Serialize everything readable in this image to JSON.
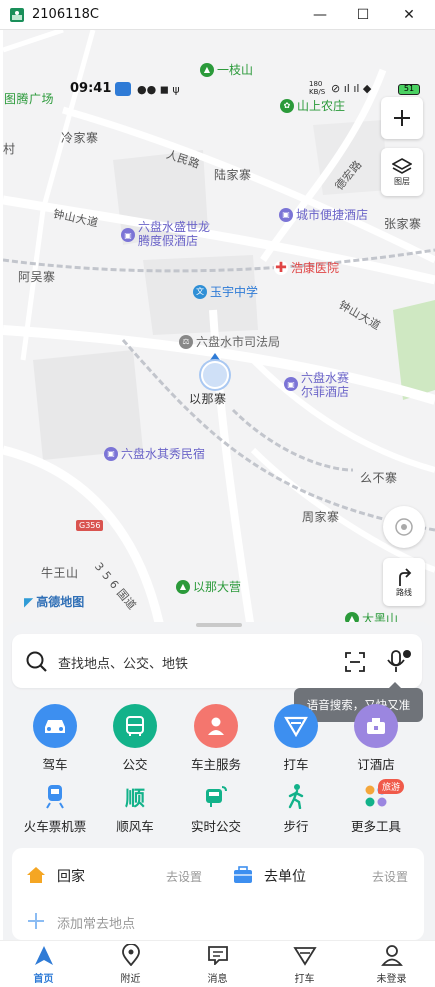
{
  "window": {
    "title": "2106118C",
    "minimize": "—",
    "maximize": "☐",
    "close": "✕"
  },
  "status": {
    "time": "09:41",
    "speed": "180\nKB/S",
    "battery": "51"
  },
  "map": {
    "labels": [
      "一枝山",
      "图腾广场",
      "山上农庄",
      "冷家寨",
      "村",
      "人民路",
      "陆家寨",
      "德宏路",
      "钟山大道",
      "六盘水盛世龙",
      "腾度假酒店",
      "城市便捷酒店",
      "张家寨",
      "阿吴寨",
      "浩康医院",
      "玉宇中学",
      "钟山大道",
      "六盘水市司法局",
      "以那寨",
      "六盘水赛",
      "尔菲酒店",
      "六盘水其秀民宿",
      "么不寨",
      "周家寨",
      "G356",
      "牛王山",
      "3 5 6 国道",
      "以那大营",
      "高德地图",
      "大黑山"
    ],
    "layers_label": "图层",
    "route_label": "路线"
  },
  "search": {
    "placeholder": "查找地点、公交、地铁"
  },
  "tooltip": "语音搜索，又快又准",
  "quick_actions": [
    "驾车",
    "公交",
    "车主服务",
    "打车",
    "订酒店"
  ],
  "secondary_actions": [
    "火车票机票",
    "顺风车",
    "实时公交",
    "步行",
    "更多工具"
  ],
  "more_badge": "旅游",
  "shortcuts": {
    "home": "回家",
    "home_set": "去设置",
    "work": "去单位",
    "work_set": "去设置",
    "add": "添加常去地点"
  },
  "tabs": [
    "首页",
    "附近",
    "消息",
    "打车",
    "未登录"
  ],
  "colors": {
    "accent": "#2f7bd6",
    "drive": "#3d8ff0",
    "bus": "#13b28a",
    "owner": "#f4766e",
    "taxi": "#3d8ff0",
    "hotel": "#9b86e0"
  }
}
